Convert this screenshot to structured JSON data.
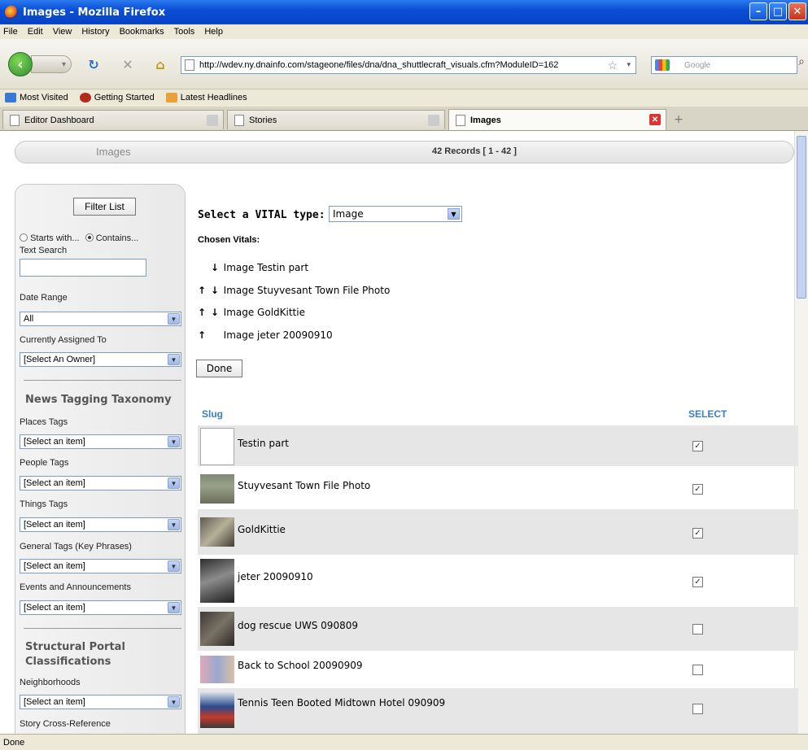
{
  "window": {
    "title": "Images - Mozilla Firefox"
  },
  "menu": [
    "File",
    "Edit",
    "View",
    "History",
    "Bookmarks",
    "Tools",
    "Help"
  ],
  "nav": {
    "url": "http://wdev.ny.dnainfo.com/stageone/files/dna/dna_shuttlecraft_visuals.cfm?ModuleID=162",
    "search_placeholder": "Google"
  },
  "bookmarks": [
    "Most Visited",
    "Getting Started",
    "Latest Headlines"
  ],
  "tabs": [
    {
      "label": "Editor Dashboard",
      "active": false
    },
    {
      "label": "Stories",
      "active": false
    },
    {
      "label": "Images",
      "active": true
    }
  ],
  "header": {
    "title": "Images",
    "count": "42 Records  [ 1 - 42 ]"
  },
  "sidebar": {
    "filter_button": "Filter List",
    "radio_starts": "Starts with...",
    "radio_contains": "Contains...",
    "text_search_label": "Text Search",
    "date_range_label": "Date Range",
    "date_range_value": "All",
    "assigned_label": "Currently Assigned To",
    "assigned_value": "[Select An Owner]",
    "taxonomy_heading": "News Tagging Taxonomy",
    "places_label": "Places Tags",
    "people_label": "People Tags",
    "things_label": "Things Tags",
    "general_label": "General Tags (Key Phrases)",
    "events_label": "Events and Announcements",
    "select_item": "[Select an item]",
    "structural_heading_1": "Structural Portal",
    "structural_heading_2": "Classifications",
    "neighborhoods_label": "Neighborhoods",
    "crossref_label": "Story Cross-Reference"
  },
  "main": {
    "vital_label": "Select a VITAL type:",
    "vital_value": "Image",
    "chosen_label": "Chosen Vitals:",
    "chosen": [
      {
        "up": "",
        "down": "↓",
        "text": "Image Testin part"
      },
      {
        "up": "↑",
        "down": "↓",
        "text": "Image Stuyvesant Town File Photo"
      },
      {
        "up": "↑",
        "down": "↓",
        "text": "Image GoldKittie"
      },
      {
        "up": "↑",
        "down": "",
        "text": "Image jeter 20090910"
      }
    ],
    "done_button": "Done",
    "col_slug": "Slug",
    "col_select": "SELECT",
    "rows": [
      {
        "slug": "Testin part",
        "checked": true
      },
      {
        "slug": "Stuyvesant Town File Photo",
        "checked": true
      },
      {
        "slug": "GoldKittie",
        "checked": true
      },
      {
        "slug": "jeter 20090910",
        "checked": true
      },
      {
        "slug": "dog rescue UWS 090809",
        "checked": false
      },
      {
        "slug": "Back to School 20090909",
        "checked": false
      },
      {
        "slug": "Tennis Teen Booted Midtown Hotel 090909",
        "checked": false
      }
    ],
    "checkmark": "✓"
  },
  "status": "Done"
}
